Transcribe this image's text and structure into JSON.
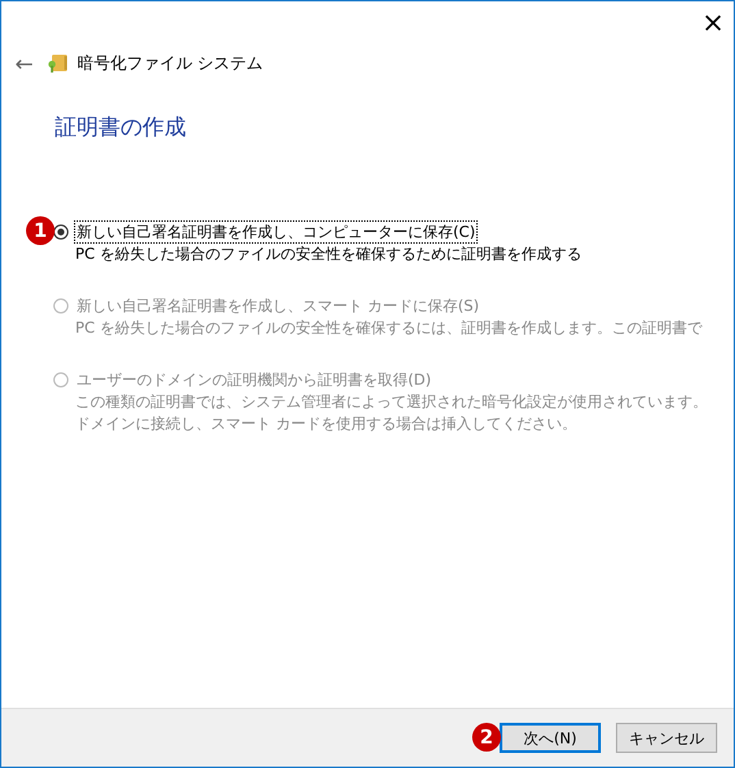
{
  "window": {
    "title": "暗号化ファイル システム",
    "close": "×",
    "back": "←"
  },
  "heading": "証明書の作成",
  "options": [
    {
      "label": "新しい自己署名証明書を作成し、コンピューターに保存(C)",
      "description": [
        "PC を紛失した場合のファイルの安全性を確保するために証明書を作成する"
      ],
      "selected": true,
      "disabled": false,
      "focused": true,
      "badge": "1"
    },
    {
      "label": "新しい自己署名証明書を作成し、スマート カードに保存(S)",
      "description": [
        "PC を紛失した場合のファイルの安全性を確保するには、証明書を作成します。この証明書で"
      ],
      "selected": false,
      "disabled": true,
      "focused": false
    },
    {
      "label": "ユーザーのドメインの証明機関から証明書を取得(D)",
      "description": [
        "この種類の証明書では、システム管理者によって選択された暗号化設定が使用されています。",
        "ドメインに接続し、スマート カードを使用する場合は挿入してください。"
      ],
      "selected": false,
      "disabled": true,
      "focused": false
    }
  ],
  "buttons": [
    {
      "label": "次へ(N)",
      "default": true,
      "badge": "2"
    },
    {
      "label": "キャンセル",
      "default": false
    }
  ]
}
